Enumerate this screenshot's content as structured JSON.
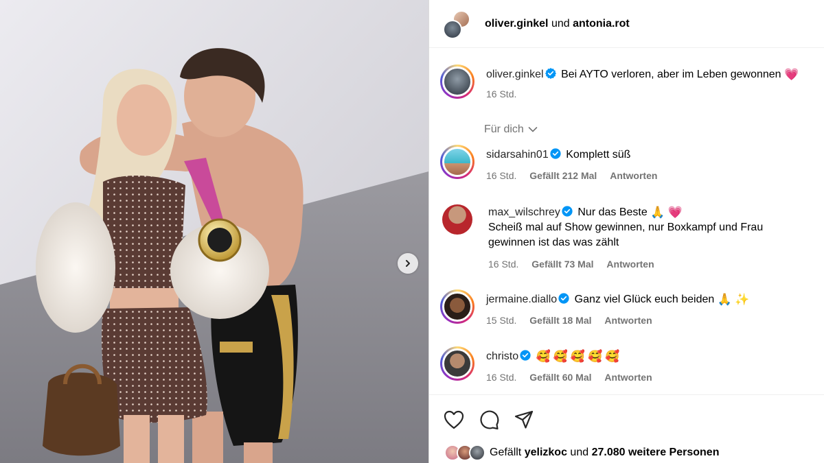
{
  "header": {
    "user1": "oliver.ginkel",
    "connector": "und",
    "user2": "antonia.rot"
  },
  "caption": {
    "username": "oliver.ginkel",
    "text": "Bei AYTO verloren, aber im Leben gewonnen",
    "emoji": "💗",
    "time": "16 Std."
  },
  "filter": {
    "label": "Für dich"
  },
  "comments": [
    {
      "username": "sidarsahin01",
      "text": "Komplett süß",
      "emoji": "",
      "time": "16 Std.",
      "likes": "Gefällt 212 Mal",
      "reply": "Antworten"
    },
    {
      "username": "max_wilschrey",
      "text": "Nur das Beste",
      "emoji1": "🙏",
      "emoji2": "💗",
      "line2": "Scheiß mal auf Show gewinnen, nur Boxkampf und Frau",
      "line3": "gewinnen ist das was zählt",
      "time": "16 Std.",
      "likes": "Gefällt 73 Mal",
      "reply": "Antworten"
    },
    {
      "username": "jermaine.diallo",
      "text": "Ganz viel Glück euch beiden",
      "emoji1": "🙏",
      "emoji2": "✨",
      "time": "15 Std.",
      "likes": "Gefällt 18 Mal",
      "reply": "Antworten"
    },
    {
      "username": "christo",
      "text": "",
      "emoji": "🥰🥰🥰🥰🥰",
      "time": "16 Std.",
      "likes": "Gefällt 60 Mal",
      "reply": "Antworten"
    }
  ],
  "likes_bar": {
    "prefix": "Gefällt",
    "user": "yelizkoc",
    "connector": "und",
    "others": "27.080 weitere Personen"
  },
  "icons": {
    "like": "heart-icon",
    "comment": "comment-icon",
    "share": "share-icon",
    "next": "chevron-right-icon",
    "verified": "verified-badge-icon"
  },
  "colors": {
    "verified": "#0095f6",
    "meta_text": "#737373",
    "ring_gradient": [
      "#feda75",
      "#fa7e1e",
      "#d62976",
      "#962fbf",
      "#4f5bd5"
    ]
  }
}
